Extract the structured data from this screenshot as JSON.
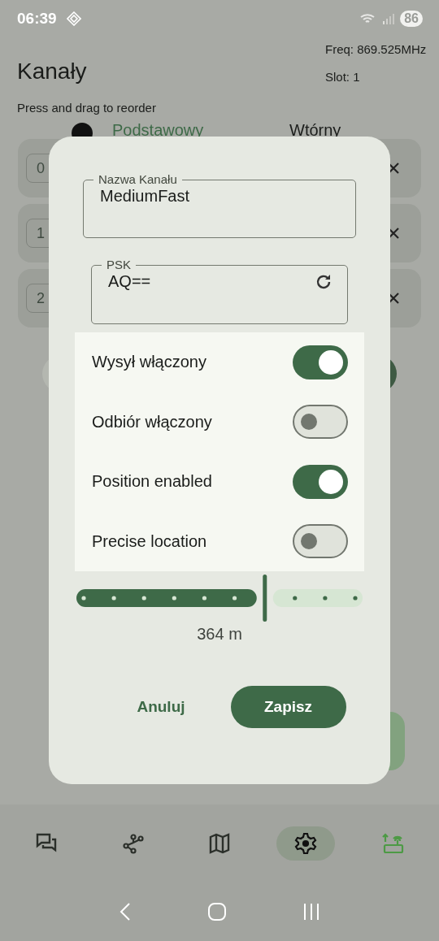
{
  "status_bar": {
    "time": "06:39",
    "battery": "86"
  },
  "header": {
    "title": "Kanały",
    "freq": "Freq: 869.525MHz",
    "slot": "Slot: 1",
    "hint": "Press and drag to reorder"
  },
  "column_headers": [
    {
      "label": "Podstawowy",
      "highlighted": true
    },
    {
      "label": "Wtórny",
      "highlighted": false
    }
  ],
  "channels": [
    {
      "index": "0"
    },
    {
      "index": "1"
    },
    {
      "index": "2"
    }
  ],
  "dialog": {
    "name_field": {
      "label": "Nazwa Kanału",
      "value": "MediumFast"
    },
    "psk_field": {
      "label": "PSK",
      "value": "AQ=="
    },
    "toggles": [
      {
        "label": "Wysył włączony",
        "on": true
      },
      {
        "label": "Odbiór włączony",
        "on": false
      },
      {
        "label": "Position enabled",
        "on": true
      },
      {
        "label": "Precise location",
        "on": false
      }
    ],
    "slider": {
      "level": 0.667,
      "reading": "364 m"
    },
    "buttons": [
      {
        "label": "Anuluj",
        "kind": "text"
      },
      {
        "label": "Zapisz",
        "kind": "filled"
      }
    ]
  },
  "nav": [
    {
      "selected": false
    },
    {
      "selected": false
    },
    {
      "selected": false
    },
    {
      "selected": true
    },
    {
      "selected": false
    }
  ]
}
